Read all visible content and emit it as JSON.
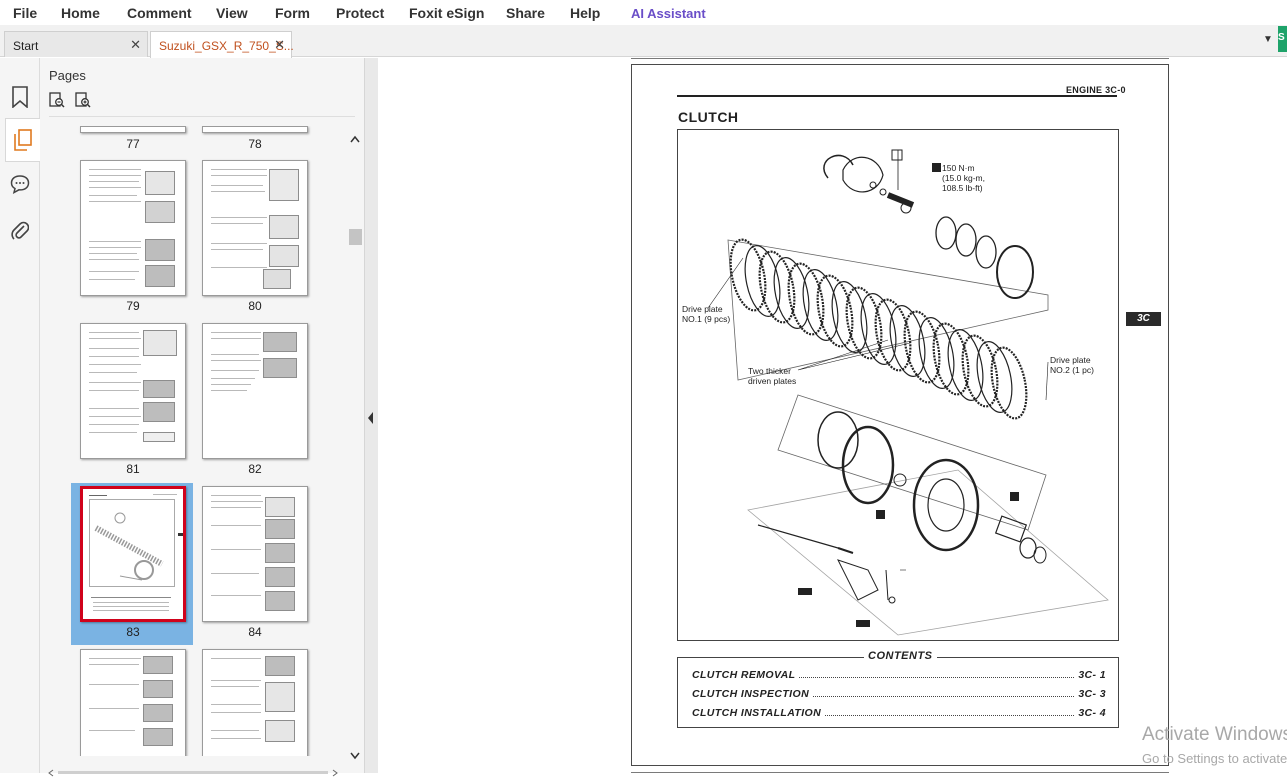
{
  "menu": {
    "file": "File",
    "home": "Home",
    "comment": "Comment",
    "view": "View",
    "form": "Form",
    "protect": "Protect",
    "esign": "Foxit eSign",
    "share": "Share",
    "help": "Help",
    "ai": "AI Assistant"
  },
  "tabs": [
    {
      "label": "Start"
    },
    {
      "label": "Suzuki_GSX_R_750_S..."
    }
  ],
  "panel": {
    "title": "Pages",
    "thumbnails": [
      {
        "page": "77"
      },
      {
        "page": "78"
      },
      {
        "page": "79"
      },
      {
        "page": "80"
      },
      {
        "page": "81"
      },
      {
        "page": "82"
      },
      {
        "page": "83",
        "selected": true
      },
      {
        "page": "84"
      }
    ]
  },
  "document": {
    "header": "ENGINE  3C-0",
    "title": "CLUTCH",
    "section_tab": "3C",
    "labels": {
      "torque_1": "150 N·m",
      "torque_2": "(15.0 kg-m,",
      "torque_3": "108.5 lb-ft)",
      "drive1_a": "Drive plate",
      "drive1_b": "NO.1 (9 pcs)",
      "thick_a": "Two thicker",
      "thick_b": "driven plates",
      "drive2_a": "Drive plate",
      "drive2_b": "NO.2 (1 pc)"
    },
    "contents": {
      "title": "CONTENTS",
      "items": [
        {
          "name": "CLUTCH REMOVAL",
          "page": "3C- 1"
        },
        {
          "name": "CLUTCH INSPECTION",
          "page": "3C- 3"
        },
        {
          "name": "CLUTCH INSTALLATION",
          "page": "3C- 4"
        }
      ]
    }
  },
  "watermark": {
    "line1": "Activate Windows",
    "line2": "Go to Settings to activate Windows."
  },
  "colors": {
    "accent_tab_text": "#c0501e",
    "ai_assistant": "#6a4ec8",
    "selection": "#7ab3e3",
    "selection_border": "#d0021b",
    "green_button": "#1ea36a"
  }
}
